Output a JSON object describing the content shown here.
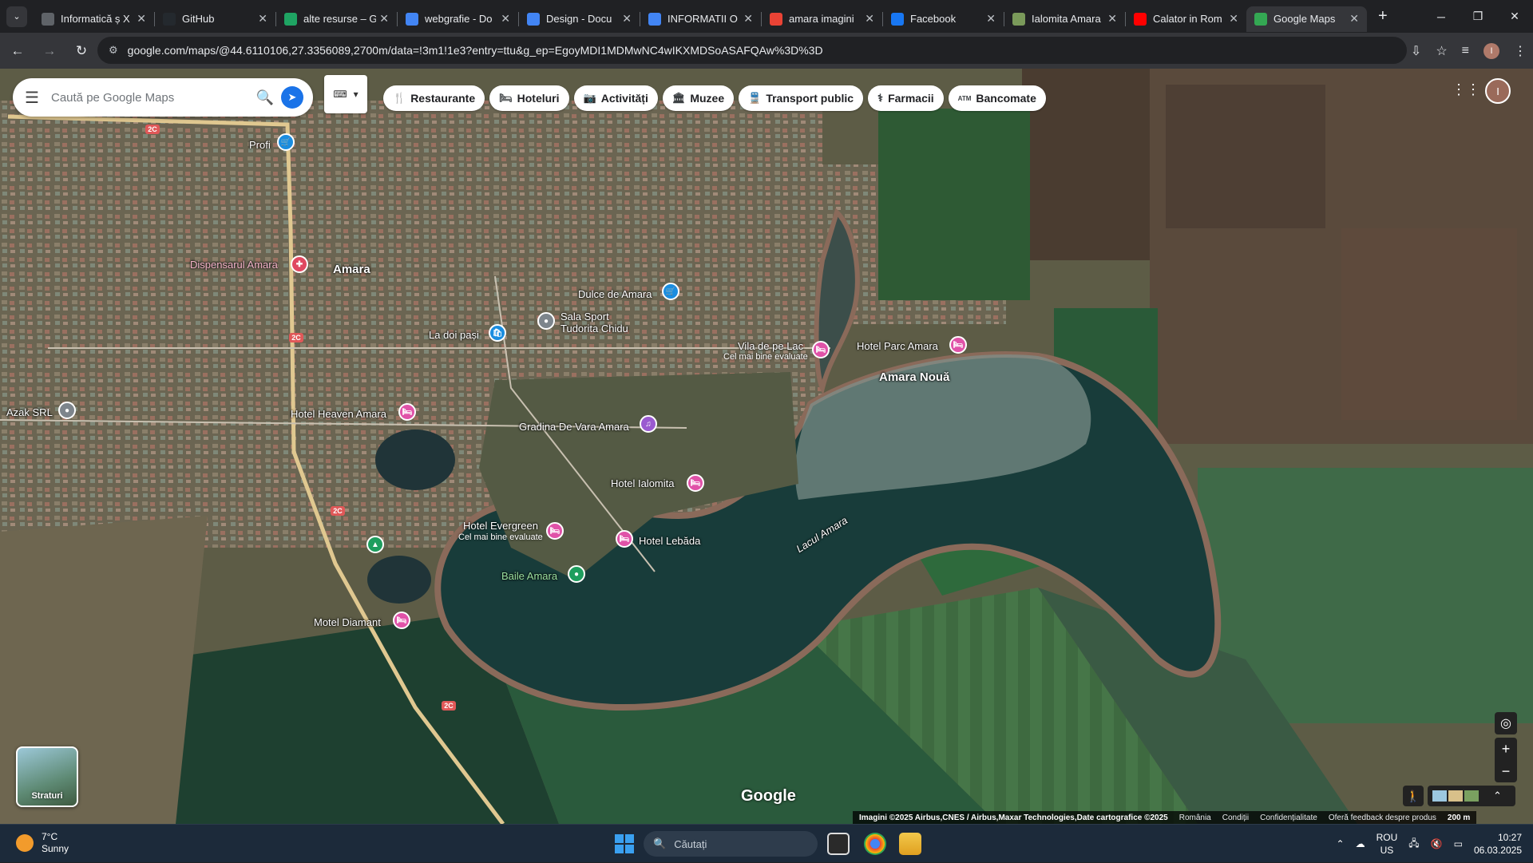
{
  "browser": {
    "tabs": [
      {
        "title": "Informatică ș X",
        "icon": "page-icon",
        "color": "#5f6368"
      },
      {
        "title": "GitHub",
        "icon": "github-icon",
        "color": "#24292e"
      },
      {
        "title": "alte resurse – G",
        "icon": "drive-icon",
        "color": "#1fa463"
      },
      {
        "title": "webgrafie - Do",
        "icon": "docs-icon",
        "color": "#4285f4"
      },
      {
        "title": "Design - Docu",
        "icon": "docs-icon",
        "color": "#4285f4"
      },
      {
        "title": "INFORMATII O",
        "icon": "docs-icon",
        "color": "#4285f4"
      },
      {
        "title": "amara imagini",
        "icon": "google-icon",
        "color": "#ea4335"
      },
      {
        "title": "Facebook",
        "icon": "facebook-icon",
        "color": "#1877f2"
      },
      {
        "title": "Ialomita Amara",
        "icon": "image-icon",
        "color": "#7a9a5a"
      },
      {
        "title": "Calator in Rom",
        "icon": "youtube-icon",
        "color": "#ff0000"
      },
      {
        "title": "Google Maps",
        "icon": "maps-icon",
        "color": "#34a853"
      }
    ],
    "url": "google.com/maps/@44.6110106,27.3356089,2700m/data=!3m1!1e3?entry=ttu&g_ep=EgoyMDI1MDMwNC4wIKXMDSoASAFQAw%3D%3D",
    "profile_initial": "I"
  },
  "maps": {
    "search_placeholder": "Caută pe Google Maps",
    "chips": [
      {
        "label": "Restaurante",
        "icon": "fork-knife-icon",
        "glyph": "🍴"
      },
      {
        "label": "Hoteluri",
        "icon": "bed-icon",
        "glyph": "🛏"
      },
      {
        "label": "Activități",
        "icon": "camera-icon",
        "glyph": "📷"
      },
      {
        "label": "Muzee",
        "icon": "museum-icon",
        "glyph": "🏛"
      },
      {
        "label": "Transport public",
        "icon": "train-icon",
        "glyph": "🚆"
      },
      {
        "label": "Farmacii",
        "icon": "pharmacy-icon",
        "glyph": "⚕"
      },
      {
        "label": "Bancomate",
        "icon": "atm-icon",
        "glyph": "ATM"
      }
    ],
    "account_initial": "I",
    "places": {
      "amara": "Amara",
      "amara_noua": "Amara Nouă",
      "lacul_amara": "Lacul Amara",
      "profi": "Profi",
      "dispensar": "Dispensarul Amara",
      "dulce": "Dulce de Amara",
      "sala_sport_1": "Sala Sport",
      "sala_sport_2": "Tudorita Chidu",
      "la_doi_pasi": "La doi pași",
      "vila": "Vila de pe Lac",
      "vila_sub": "Cel mai bine evaluate",
      "parc": "Hotel Parc Amara",
      "azak": "Azak SRL",
      "heaven": "Hotel Heaven Amara",
      "gradina": "Gradina De Vara Amara",
      "ialomita": "Hotel Ialomita",
      "evergreen": "Hotel Evergreen",
      "evergreen_sub": "Cel mai bine evaluate",
      "lebada": "Hotel Lebăda",
      "baile": "Baile Amara",
      "diamant": "Motel Diamant",
      "road": "2C"
    },
    "layers_label": "Straturi",
    "google_logo": "Google",
    "attribution": "Imagini ©2025 Airbus,CNES / Airbus,Maxar Technologies,Date cartografice ©2025",
    "footer_links": [
      "România",
      "Condiții",
      "Confidențialitate",
      "Oferă feedback despre produs"
    ],
    "scale": "200 m"
  },
  "taskbar": {
    "weather_temp": "7°C",
    "weather_desc": "Sunny",
    "search_placeholder": "Căutați",
    "lang_1": "ROU",
    "lang_2": "US",
    "time": "10:27",
    "date": "06.03.2025"
  }
}
